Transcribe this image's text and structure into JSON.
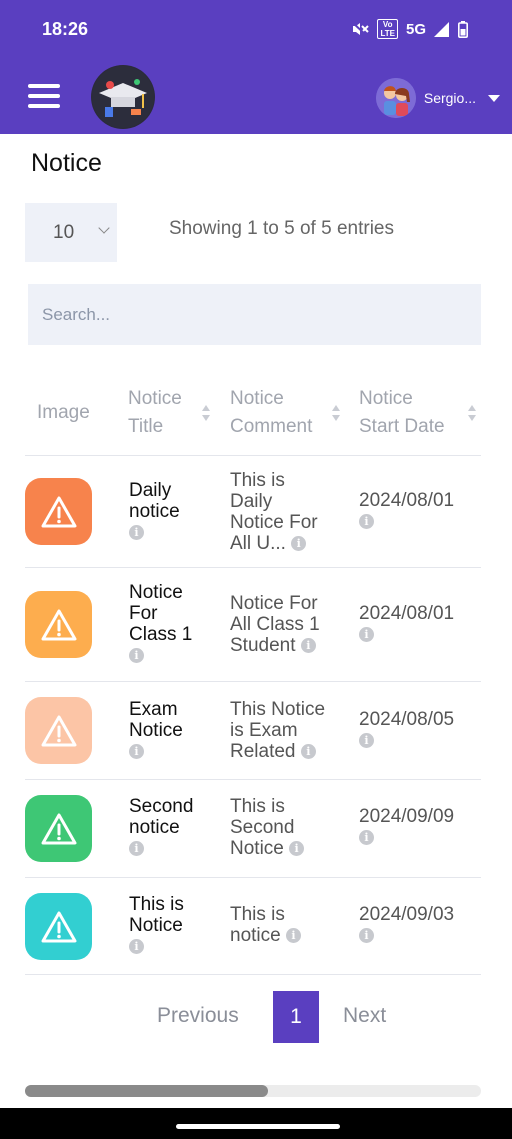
{
  "status_bar": {
    "time": "18:26",
    "network": "5G",
    "volte_top": "Vo",
    "volte_bottom": "LTE",
    "icons": [
      "mute-icon",
      "volte-icon",
      "signal-icon",
      "battery-icon"
    ]
  },
  "app_bar": {
    "menu_icon": "hamburger-icon",
    "user_name": "Sergio...",
    "background": "#5a3fc0"
  },
  "page": {
    "title": "Notice"
  },
  "table_controls": {
    "page_length": "10",
    "info": "Showing 1 to 5 of 5 entries",
    "search_placeholder": "Search..."
  },
  "table": {
    "headers": {
      "image": "Image",
      "title_line1": "Notice",
      "title_line2": "Title",
      "comment_line1": "Notice",
      "comment_line2": "Comment",
      "date_line1": "Notice",
      "date_line2": "Start Date"
    },
    "rows": [
      {
        "title": [
          "Daily",
          "notice"
        ],
        "comment": [
          "This is",
          "Daily",
          "Notice For",
          "All U..."
        ],
        "date": "2024/08/01",
        "color": "#f7834c",
        "icon": "warning-icon"
      },
      {
        "title": [
          "Notice",
          "For",
          "Class 1"
        ],
        "comment": [
          "Notice For",
          "All Class 1",
          "Student"
        ],
        "date": "2024/08/01",
        "color": "#fdad4e",
        "icon": "warning-icon"
      },
      {
        "title": [
          "Exam",
          "Notice"
        ],
        "comment": [
          "This Notice",
          "is Exam",
          "Related"
        ],
        "date": "2024/08/05",
        "color": "#fcc5a6",
        "icon": "warning-icon"
      },
      {
        "title": [
          "Second",
          "notice"
        ],
        "comment": [
          "This is",
          "Second",
          "Notice"
        ],
        "date": "2024/09/09",
        "color": "#3ec775",
        "icon": "warning-icon"
      },
      {
        "title": [
          "This is",
          "Notice"
        ],
        "comment": [
          "This is",
          "notice"
        ],
        "date": "2024/09/03",
        "color": "#32cfd1",
        "icon": "warning-icon"
      }
    ]
  },
  "pagination": {
    "previous": "Previous",
    "current": "1",
    "next": "Next"
  }
}
